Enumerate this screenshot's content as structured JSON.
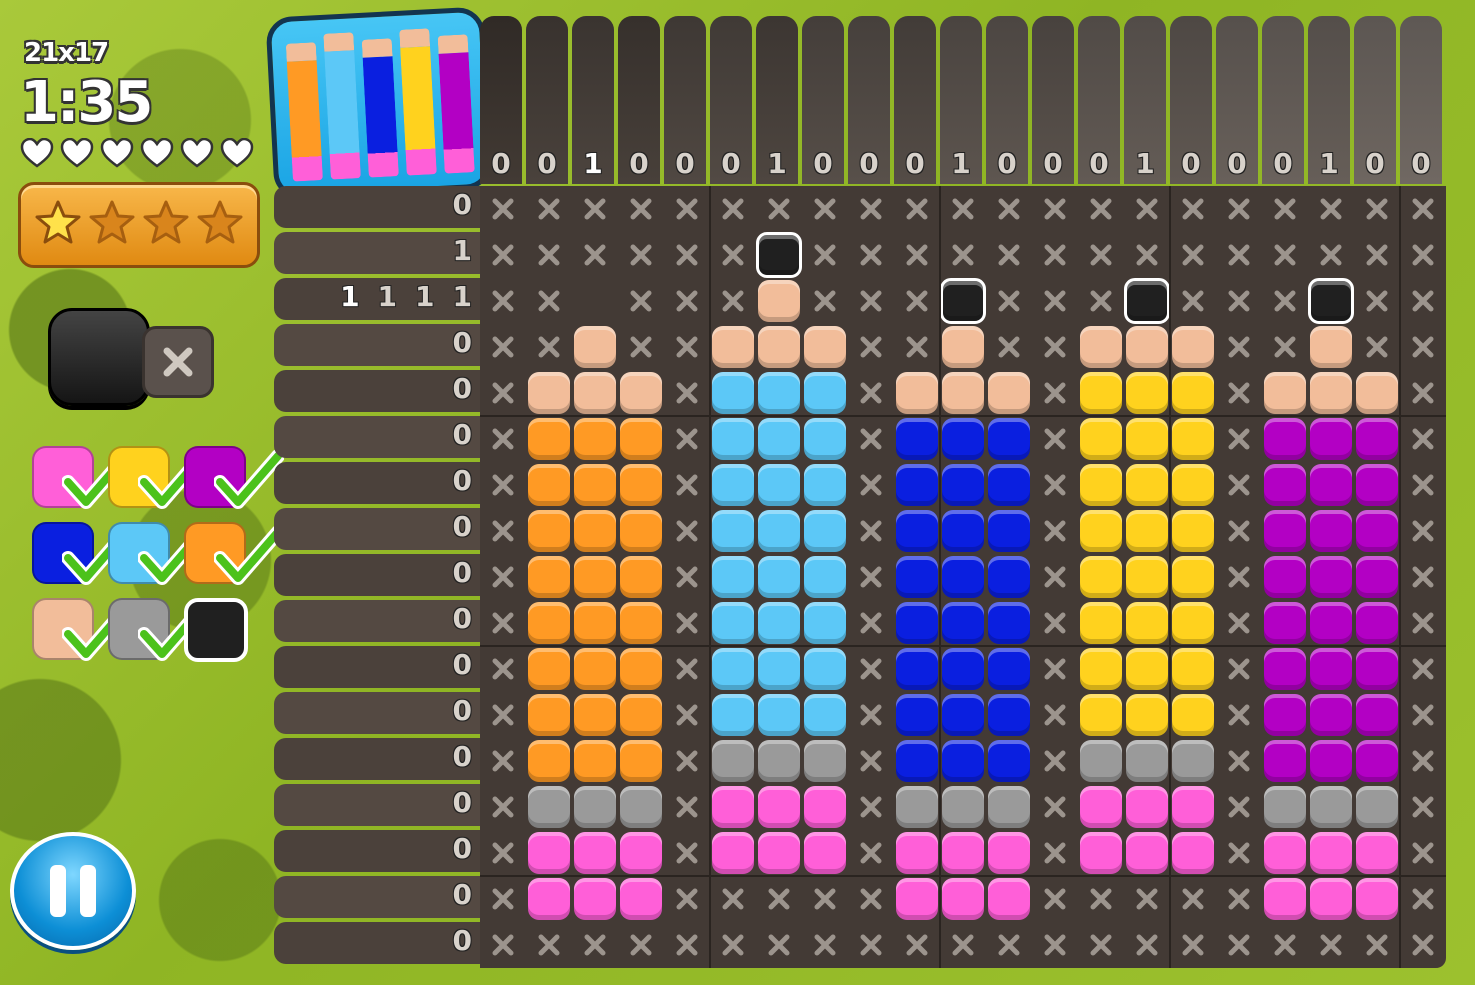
{
  "hud": {
    "size": "21x17",
    "timer": "1:35",
    "lives": 6,
    "stars_earned": 1,
    "stars_total": 4
  },
  "tools": {
    "fill_color": "#202020",
    "cross_icon": "x-mark-icon"
  },
  "palette": [
    {
      "color": "#ff5fd8",
      "done": true
    },
    {
      "color": "#ffd21e",
      "done": true
    },
    {
      "color": "#b300c4",
      "done": true
    },
    {
      "color": "#0a1fe0",
      "done": true
    },
    {
      "color": "#5cc8f7",
      "done": true
    },
    {
      "color": "#ff9a24",
      "done": true
    },
    {
      "color": "#f2bd9a",
      "done": true
    },
    {
      "color": "#9a9a9a",
      "done": true
    },
    {
      "color": "#202020",
      "done": false,
      "selected": true
    }
  ],
  "colors": {
    "O": "#ff9a24",
    "L": "#5cc8f7",
    "B": "#0a1fe0",
    "Y": "#ffd21e",
    "P": "#b300c4",
    "S": "#f2bd9a",
    "G": "#9a9a9a",
    "K": "#ff5fd8",
    "D": "#202020"
  },
  "col_clues": [
    "0",
    "0",
    "1",
    "0",
    "0",
    "0",
    "1",
    "0",
    "0",
    "0",
    "1",
    "0",
    "0",
    "0",
    "1",
    "0",
    "0",
    "0",
    "1",
    "0",
    "0"
  ],
  "col_highlight": 2,
  "row_clues": [
    [
      "0"
    ],
    [
      "1"
    ],
    [
      "1",
      "1",
      "1",
      "1"
    ],
    [
      "0"
    ],
    [
      "0"
    ],
    [
      "0"
    ],
    [
      "0"
    ],
    [
      "0"
    ],
    [
      "0"
    ],
    [
      "0"
    ],
    [
      "0"
    ],
    [
      "0"
    ],
    [
      "0"
    ],
    [
      "0"
    ],
    [
      "0"
    ],
    [
      "0"
    ],
    [
      "0"
    ]
  ],
  "grid": [
    "xxxxxxxxxxxxxxxxxxxxx",
    "xxxxxxDxxxxxxxxxxxxxx",
    "xx.xxxSxxxDxxxDxxxDxx",
    "xxSxxSSSxxSxxSSSxxSxx",
    "xSSSxLLLxSSSxYYYxSSSx",
    "xOOOxLLLxBBBxYYYxPPPx",
    "xOOOxLLLxBBBxYYYxPPPx",
    "xOOOxLLLxBBBxYYYxPPPx",
    "xOOOxLLLxBBBxYYYxPPPx",
    "xOOOxLLLxBBBxYYYxPPPx",
    "xOOOxLLLxBBBxYYYxPPPx",
    "xOOOxLLLxBBBxYYYxPPPx",
    "xOOOxGGGxBBBxGGGxPPPx",
    "xGGGxKKKxGGGxKKKxGGGx",
    "xKKKxKKKxKKKxKKKxKKKx",
    "xKKKxxxxxKKKxxxxxKKKx",
    "xxxxxxxxxxxxxxxxxxxxx"
  ]
}
